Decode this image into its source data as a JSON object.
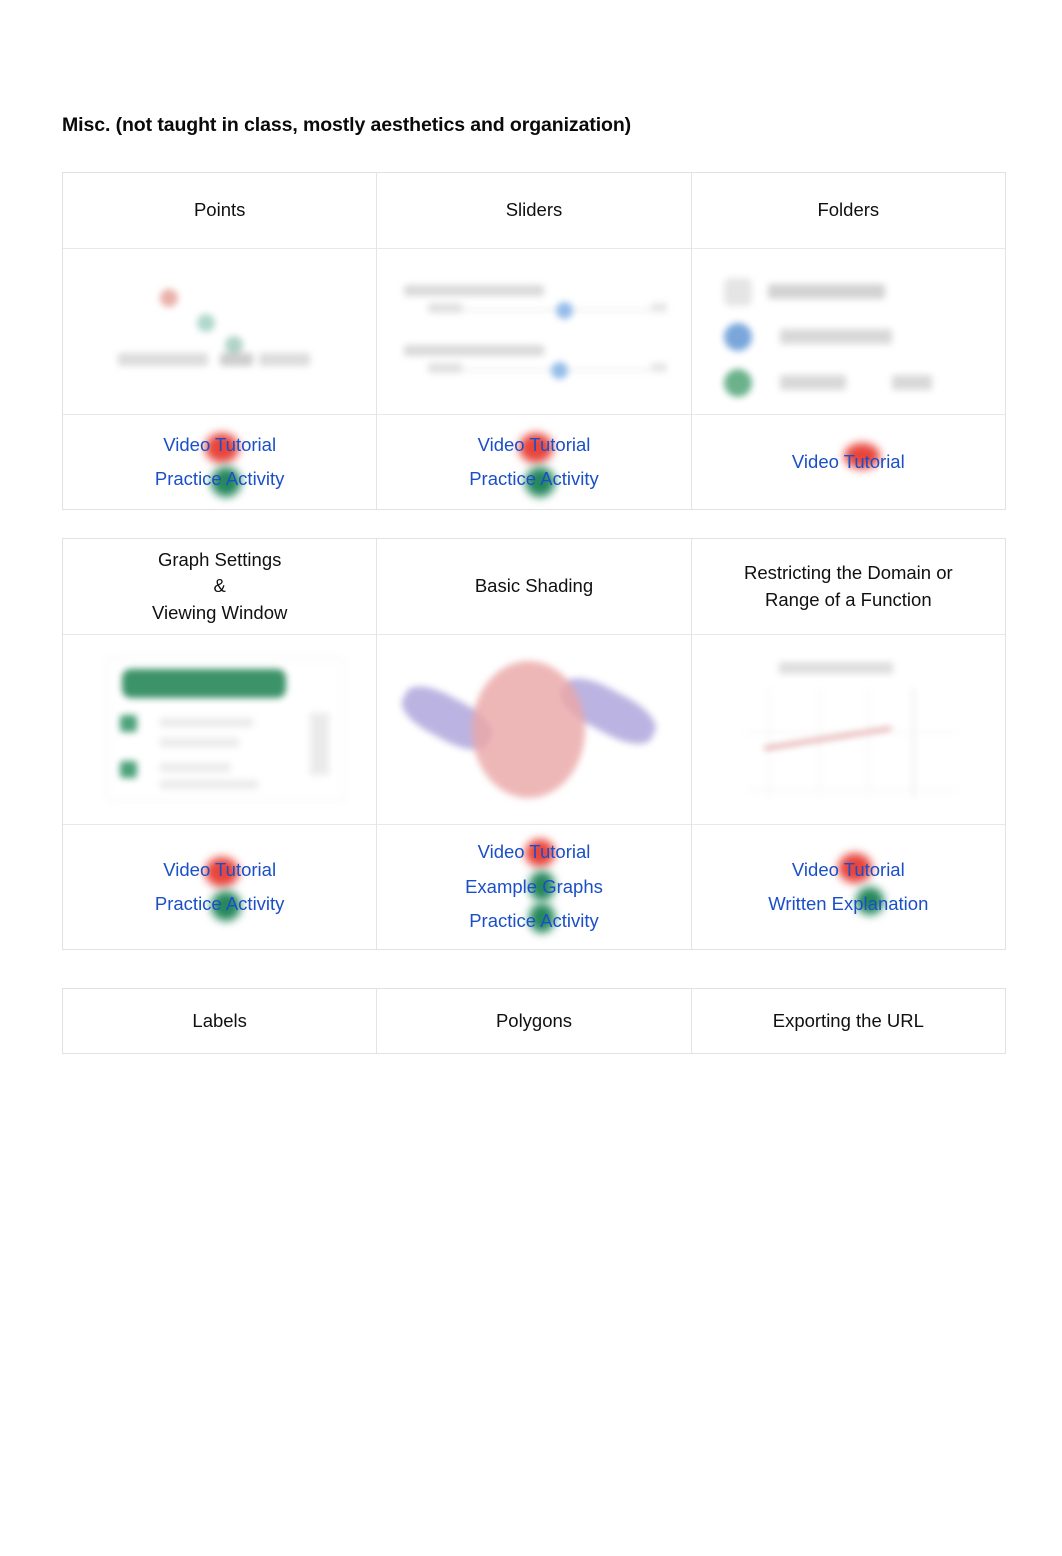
{
  "page": {
    "title": "Misc. (not taught in class, mostly aesthetics and organization)"
  },
  "colors": {
    "link": "#1a4fc7",
    "video_marker": "#e8453c",
    "resource_marker": "#26885c",
    "header_text": "#101010",
    "border": "#e2e2e2"
  },
  "rows": [
    {
      "cells": [
        {
          "title": "Points",
          "thumbnail": "points-screenshot",
          "links": [
            {
              "label": "Video Tutorial",
              "marker": "red"
            },
            {
              "label": "Practice Activity",
              "marker": "green"
            }
          ]
        },
        {
          "title": "Sliders",
          "thumbnail": "sliders-screenshot",
          "links": [
            {
              "label": "Video Tutorial",
              "marker": "red"
            },
            {
              "label": "Practice Activity",
              "marker": "green"
            }
          ]
        },
        {
          "title": "Folders",
          "thumbnail": "folders-screenshot",
          "links": [
            {
              "label": "Video Tutorial",
              "marker": "red"
            }
          ]
        }
      ]
    },
    {
      "cells": [
        {
          "title": "Graph Settings\n&\nViewing Window",
          "title_lines": [
            "Graph Settings",
            "&",
            "Viewing Window"
          ],
          "thumbnail": "graph-settings-screenshot",
          "links": [
            {
              "label": "Video Tutorial",
              "marker": "red"
            },
            {
              "label": "Practice Activity",
              "marker": "green"
            }
          ]
        },
        {
          "title": "Basic Shading",
          "thumbnail": "basic-shading-screenshot",
          "links": [
            {
              "label": "Video Tutorial",
              "marker": "red"
            },
            {
              "label": "Example Graphs",
              "marker": "green"
            },
            {
              "label": "Practice Activity",
              "marker": "green"
            }
          ]
        },
        {
          "title": "Restricting the Domain or Range of a Function",
          "title_lines": [
            "Restricting the Domain or",
            "Range of a Function"
          ],
          "thumbnail": "restricting-domain-screenshot",
          "links": [
            {
              "label": "Video Tutorial",
              "marker": "red"
            },
            {
              "label": "Written Explanation",
              "marker": "green"
            }
          ]
        }
      ]
    },
    {
      "cells": [
        {
          "title": "Labels",
          "thumbnail": null,
          "links": []
        },
        {
          "title": "Polygons",
          "thumbnail": null,
          "links": []
        },
        {
          "title": "Exporting the URL",
          "thumbnail": null,
          "links": []
        }
      ]
    }
  ]
}
